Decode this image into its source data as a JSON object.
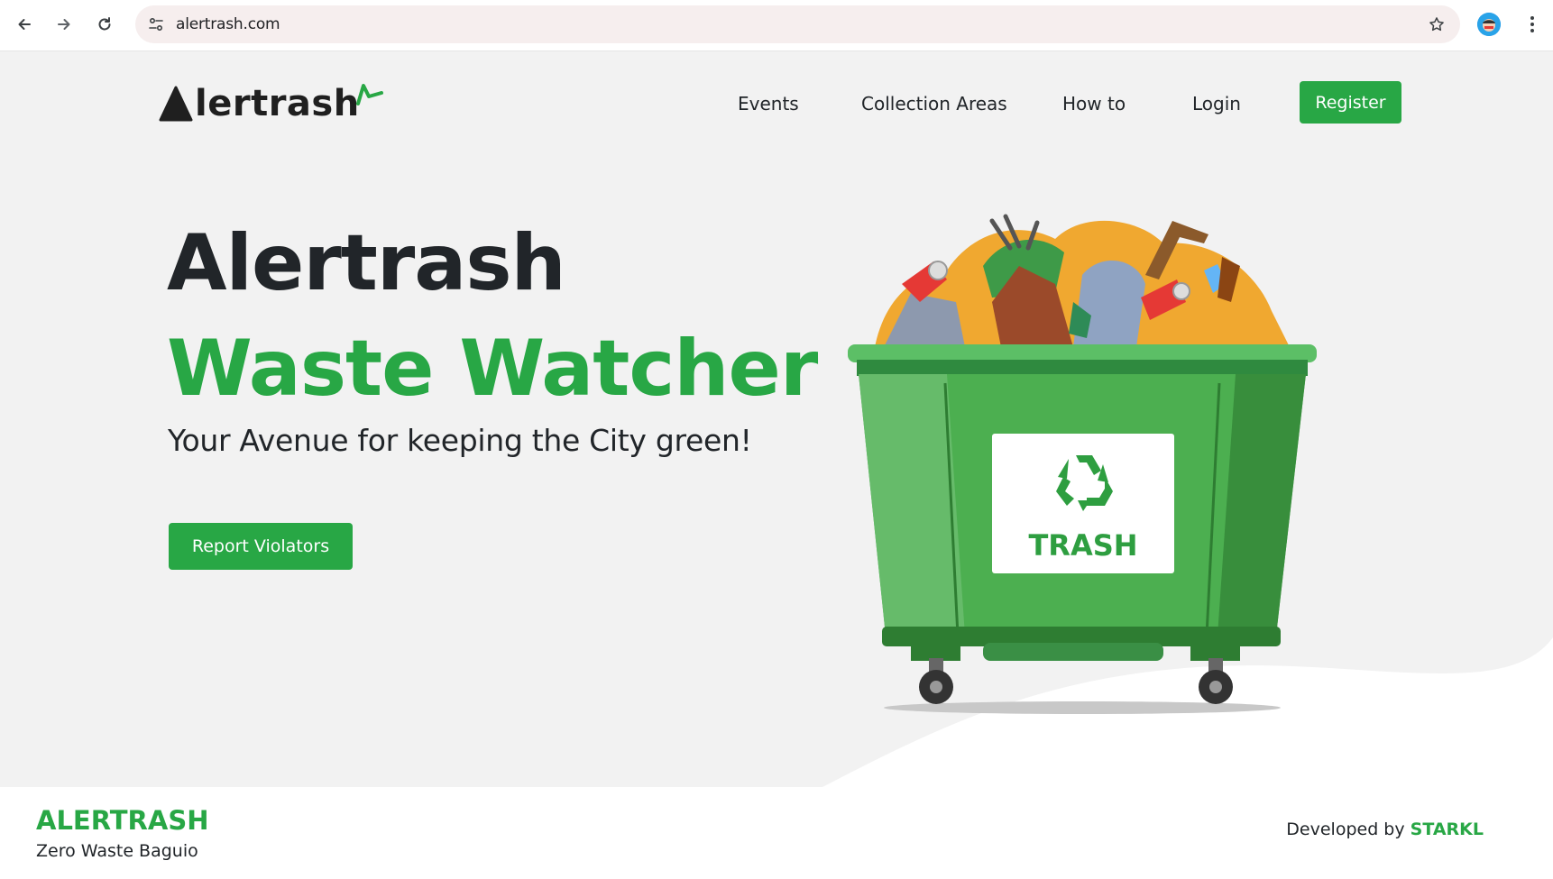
{
  "browser": {
    "url": "alertrash.com",
    "icons": [
      "back-icon",
      "forward-icon",
      "reload-icon",
      "site-info-icon",
      "star-icon",
      "profile-avatar",
      "more-icon"
    ]
  },
  "header": {
    "logo_text": "lertrash",
    "nav": [
      "Events",
      "Collection Areas",
      "How to",
      "Login"
    ],
    "register_label": "Register"
  },
  "hero": {
    "title": "Alertrash",
    "subtitle": "Waste Watcher",
    "tagline": "Your Avenue for keeping the City green!",
    "cta_label": "Report Violators",
    "bin_label": "TRASH"
  },
  "footer": {
    "brand": "ALERTRASH",
    "tagline": "Zero Waste Baguio",
    "developed_by": "Developed by ",
    "developer": "STARKL"
  },
  "colors": {
    "accent": "#28a745",
    "page_bg": "#f2f2f2",
    "text": "#212529"
  }
}
